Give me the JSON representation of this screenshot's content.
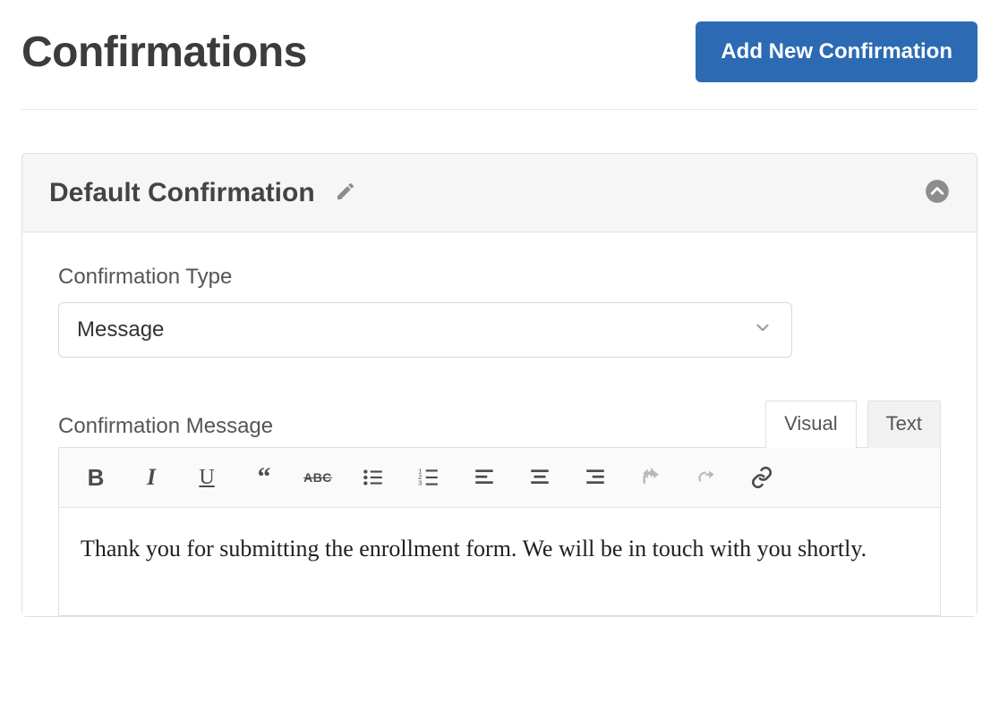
{
  "page": {
    "title": "Confirmations",
    "add_button": "Add New Confirmation"
  },
  "panel": {
    "title": "Default Confirmation"
  },
  "type_field": {
    "label": "Confirmation Type",
    "selected": "Message"
  },
  "message_field": {
    "label": "Confirmation Message",
    "tabs": {
      "visual": "Visual",
      "text": "Text"
    },
    "active_tab": "visual",
    "content": "Thank you for submitting the enrollment form. We will be in touch with you shortly."
  },
  "toolbar": {
    "bold": "B",
    "italic": "I",
    "underline": "U",
    "strike": "ABC"
  }
}
